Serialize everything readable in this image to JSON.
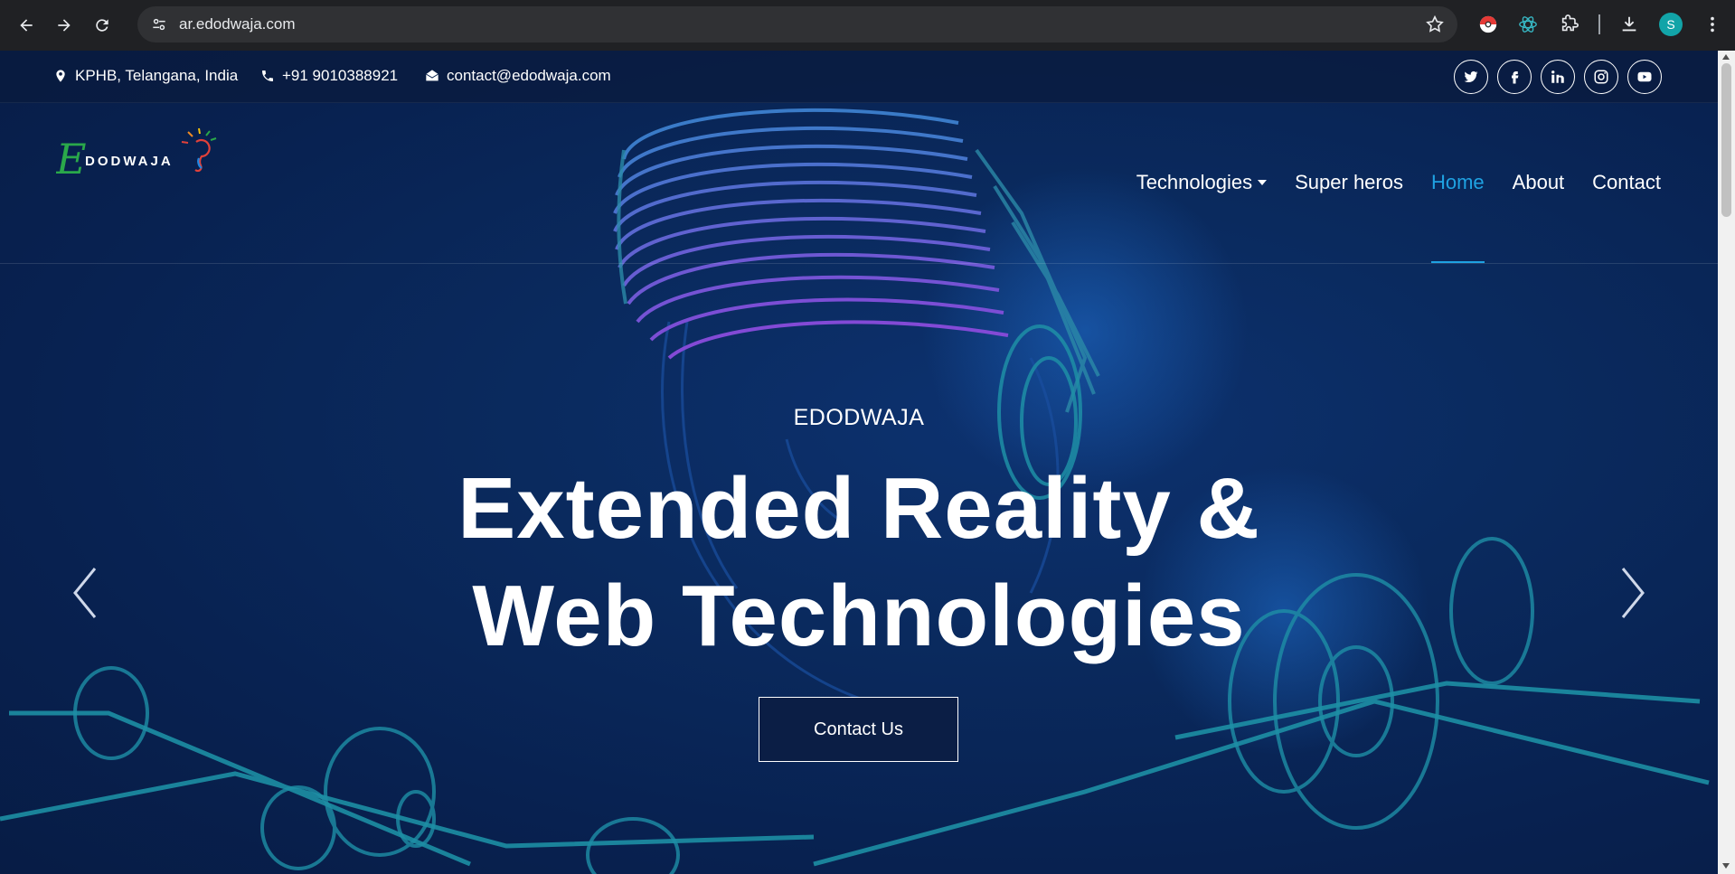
{
  "browser": {
    "url": "ar.edodwaja.com",
    "profile_initial": "S"
  },
  "topbar": {
    "location": "KPHB, Telangana, India",
    "phone": "+91 9010388921",
    "email": "contact@edodwaja.com",
    "socials": [
      "twitter-icon",
      "facebook-icon",
      "linkedin-icon",
      "instagram-icon",
      "youtube-icon"
    ]
  },
  "logo": {
    "first_letter": "E",
    "rest": "DODWAJA"
  },
  "nav": {
    "technologies": "Technologies",
    "superheros": "Super heros",
    "home": "Home",
    "about": "About",
    "contact": "Contact",
    "active_color": "#1fa2e2"
  },
  "hero": {
    "eyebrow": "EDODWAJA",
    "title_line1": "Extended Reality &",
    "title_line2": "Web Technologies",
    "cta": "Contact Us"
  }
}
